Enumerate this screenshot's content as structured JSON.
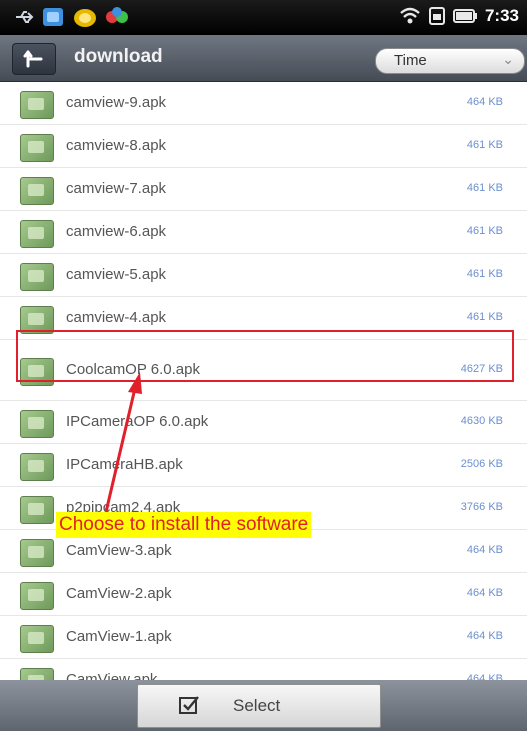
{
  "status_bar": {
    "time": "7:33"
  },
  "toolbar": {
    "title": "download",
    "sort_value": "Time"
  },
  "files": [
    {
      "name": "camview-9.apk",
      "size": "464 KB"
    },
    {
      "name": "camview-8.apk",
      "size": "461 KB"
    },
    {
      "name": "camview-7.apk",
      "size": "461 KB"
    },
    {
      "name": "camview-6.apk",
      "size": "461 KB"
    },
    {
      "name": "camview-5.apk",
      "size": "461 KB"
    },
    {
      "name": "camview-4.apk",
      "size": "461 KB"
    },
    {
      "name": "CoolcamOP 6.0.apk",
      "size": "4627 KB"
    },
    {
      "name": "IPCameraOP 6.0.apk",
      "size": "4630 KB"
    },
    {
      "name": "IPCameraHB.apk",
      "size": "2506 KB"
    },
    {
      "name": "p2pipcam2.4.apk",
      "size": "3766 KB"
    },
    {
      "name": "CamView-3.apk",
      "size": "464 KB"
    },
    {
      "name": "CamView-2.apk",
      "size": "464 KB"
    },
    {
      "name": "CamView-1.apk",
      "size": "464 KB"
    },
    {
      "name": "CamView.apk",
      "size": "464 KB"
    }
  ],
  "annotation": {
    "text": "Choose  to  install the  software"
  },
  "bottom_bar": {
    "select_label": "Select"
  },
  "colors": {
    "annotation_red": "#e0202a",
    "annotation_bg": "#ffff00",
    "size_text": "#6b8fd0"
  },
  "icons": [
    "usb-icon",
    "app-icon",
    "wifi-icon",
    "sim-icon",
    "battery-icon",
    "up-folder-icon",
    "apk-file-icon",
    "select-icon"
  ]
}
